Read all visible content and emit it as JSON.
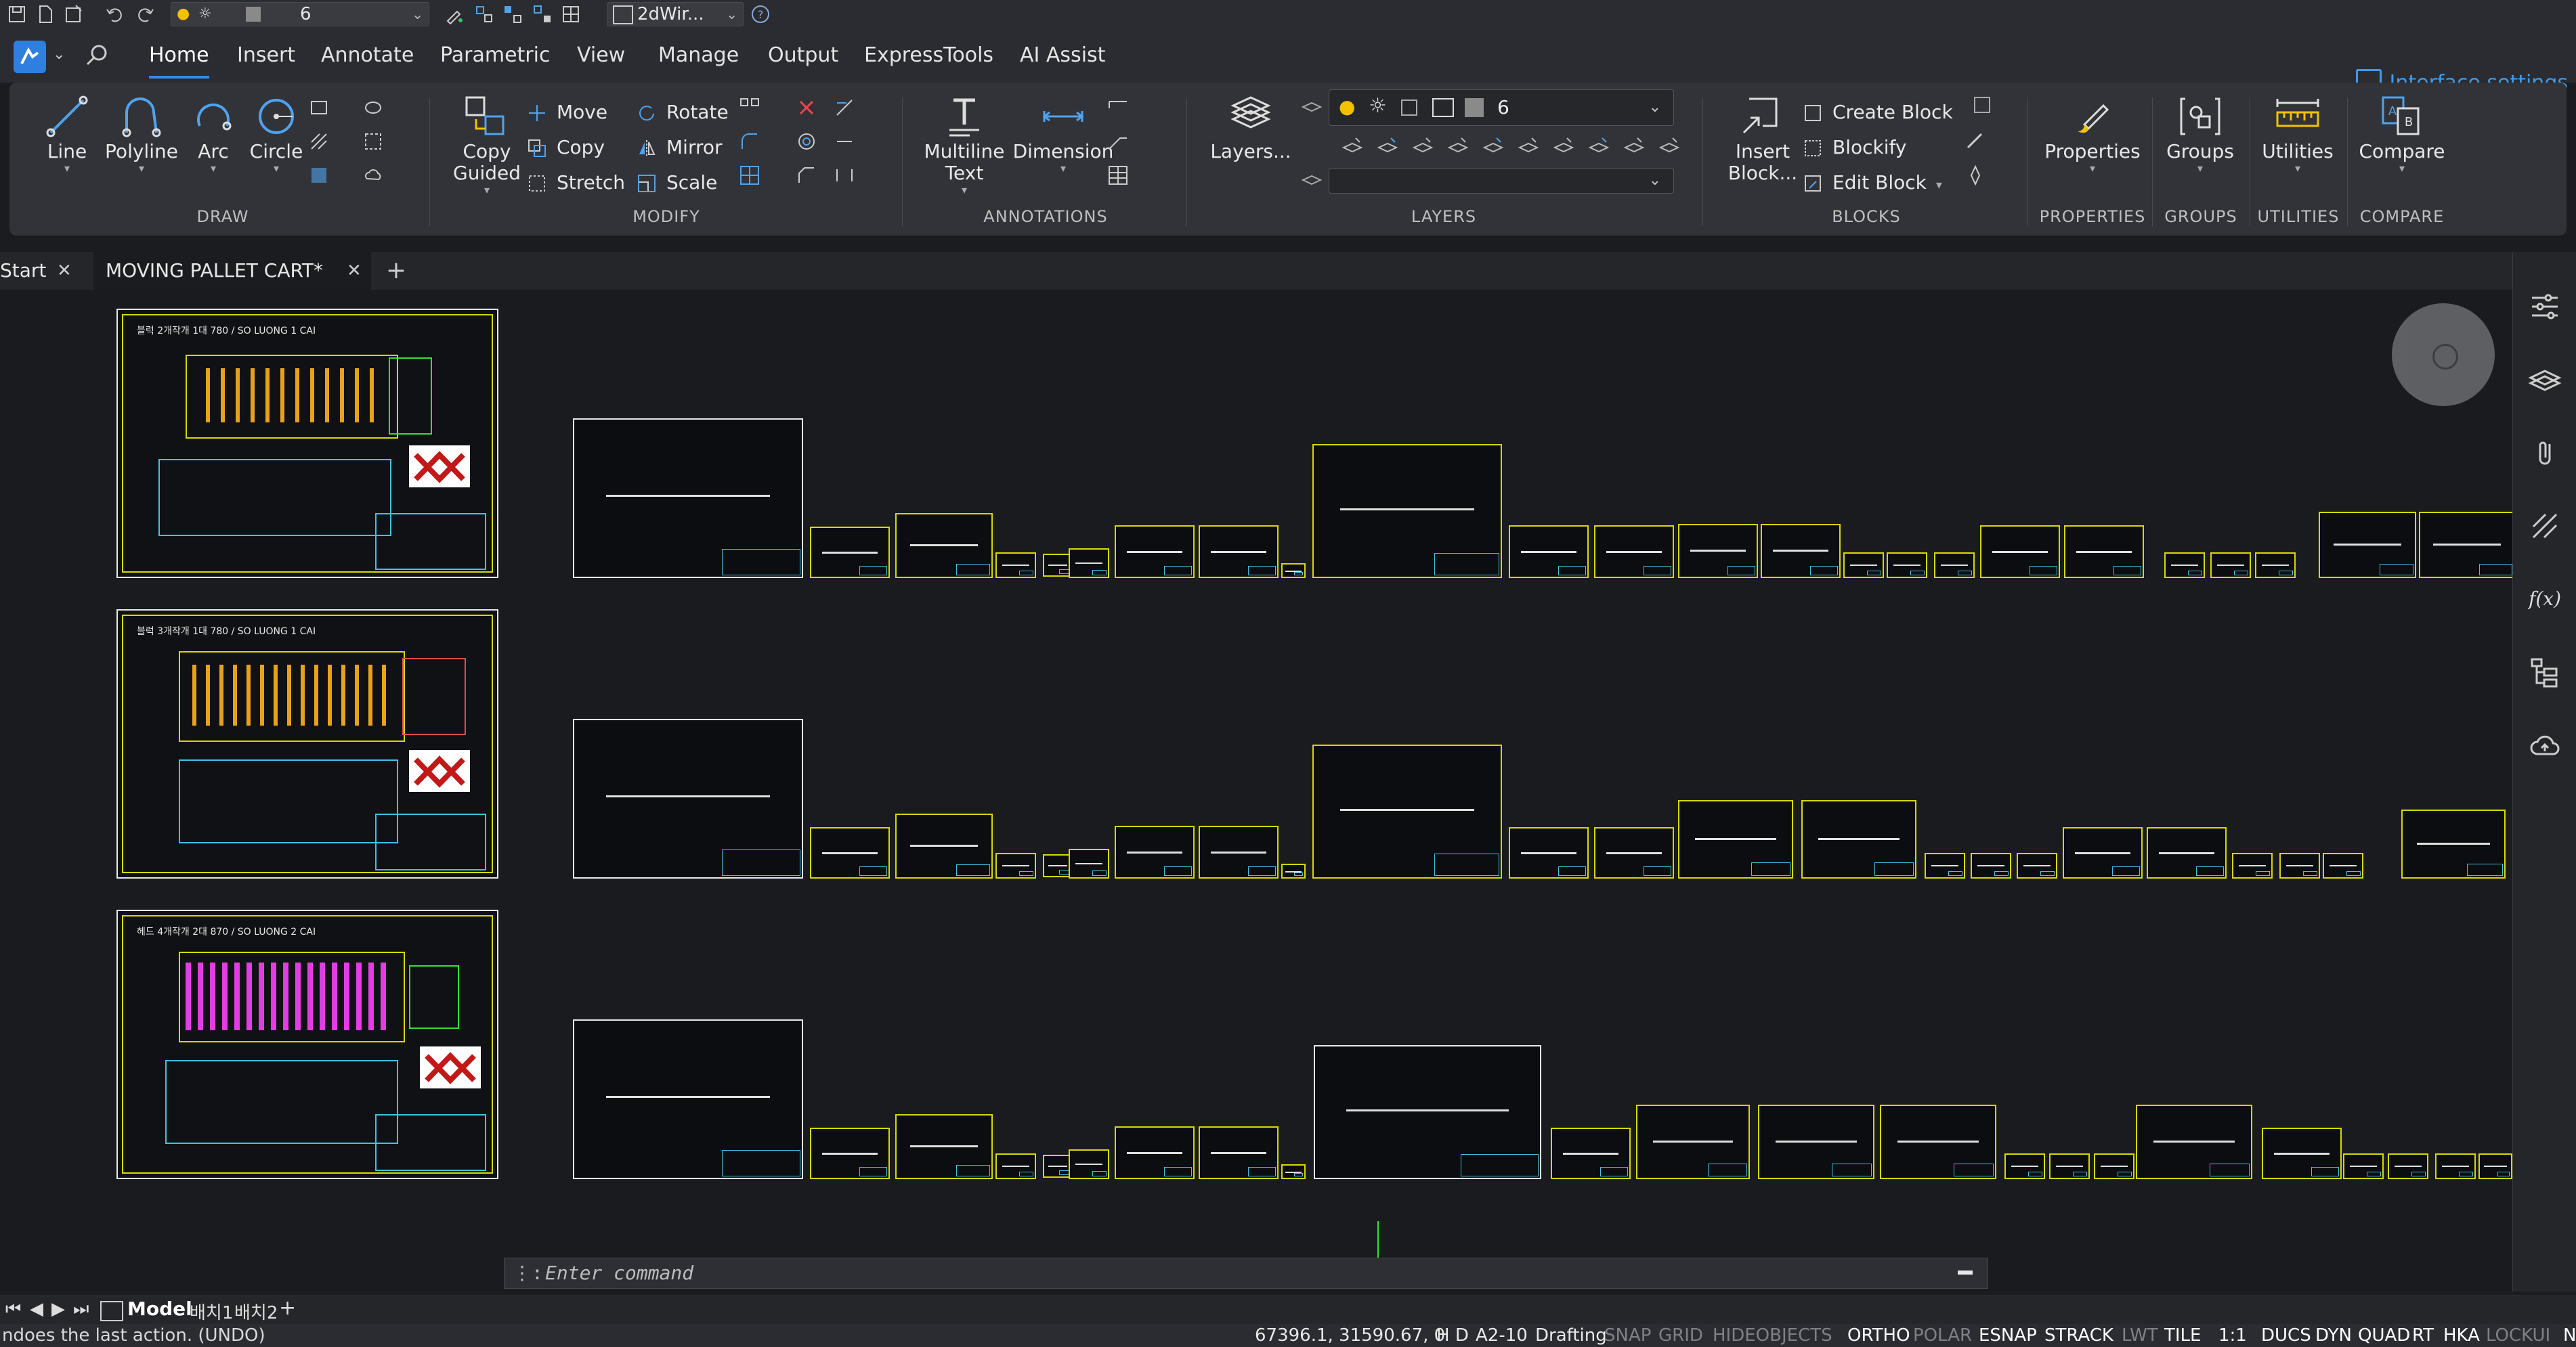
{
  "qat": {
    "visual_style_value": "6",
    "workspace_value": "2dWir..."
  },
  "ribbon_tabs": [
    "Home",
    "Insert",
    "Annotate",
    "Parametric",
    "View",
    "Manage",
    "Output",
    "ExpressTools",
    "AI Assist"
  ],
  "interface_settings_label": "Interface settings",
  "ribbon": {
    "draw": {
      "label": "DRAW",
      "line": "Line",
      "polyline": "Polyline",
      "arc": "Arc",
      "circle": "Circle"
    },
    "modify": {
      "label": "MODIFY",
      "copy_guided_1": "Copy",
      "copy_guided_2": "Guided",
      "move": "Move",
      "copy": "Copy",
      "stretch": "Stretch",
      "rotate": "Rotate",
      "mirror": "Mirror",
      "scale": "Scale"
    },
    "annotations": {
      "label": "ANNOTATIONS",
      "mtext_1": "Multiline",
      "mtext_2": "Text",
      "dimension": "Dimension"
    },
    "layers": {
      "label": "LAYERS",
      "layers_button": "Layers...",
      "layer_value": "6"
    },
    "blocks": {
      "label": "BLOCKS",
      "insert_1": "Insert",
      "insert_2": "Block...",
      "create": "Create Block",
      "blockify": "Blockify",
      "edit": "Edit Block"
    },
    "properties": {
      "label": "PROPERTIES",
      "button": "Properties"
    },
    "groups": {
      "label": "GROUPS",
      "button": "Groups"
    },
    "utilities": {
      "label": "UTILITIES",
      "button": "Utilities"
    },
    "compare": {
      "label": "COMPARE",
      "button": "Compare"
    }
  },
  "doc_tabs": {
    "start": "Start",
    "active": "MOVING PALLET CART*"
  },
  "drawing_titles": [
    "블럭 2개작개 1대 780 / SO LUONG 1 CAI",
    "블럭 3개작개 1대 780 / SO LUONG 1 CAI",
    "헤드 4개작개 2대 870 / SO LUONG 2 CAI"
  ],
  "command_line": {
    "placeholder": "Enter command"
  },
  "layout_tabs": [
    "Model",
    "배치1",
    "배치2"
  ],
  "status": {
    "message": "ndoes the last action. (UNDO)",
    "coords": "67396.1, 31590.67, 0",
    "hd": "H D",
    "paper": "A2-10",
    "workspace": "Drafting",
    "toggles": [
      {
        "label": "SNAP",
        "on": false
      },
      {
        "label": "GRID",
        "on": false
      },
      {
        "label": "HIDEOBJECTS",
        "on": false
      },
      {
        "label": "ORTHO",
        "on": true
      },
      {
        "label": "POLAR",
        "on": false
      },
      {
        "label": "ESNAP",
        "on": true
      },
      {
        "label": "STRACK",
        "on": true
      },
      {
        "label": "LWT",
        "on": false
      },
      {
        "label": "TILE",
        "on": true
      },
      {
        "label": "1:1",
        "on": true
      },
      {
        "label": "DUCS",
        "on": true
      },
      {
        "label": "DYN",
        "on": true
      },
      {
        "label": "QUAD",
        "on": true
      },
      {
        "label": "RT",
        "on": true
      },
      {
        "label": "HKA",
        "on": true
      },
      {
        "label": "LOCKUI",
        "on": false
      },
      {
        "label": "None",
        "on": true
      }
    ]
  }
}
